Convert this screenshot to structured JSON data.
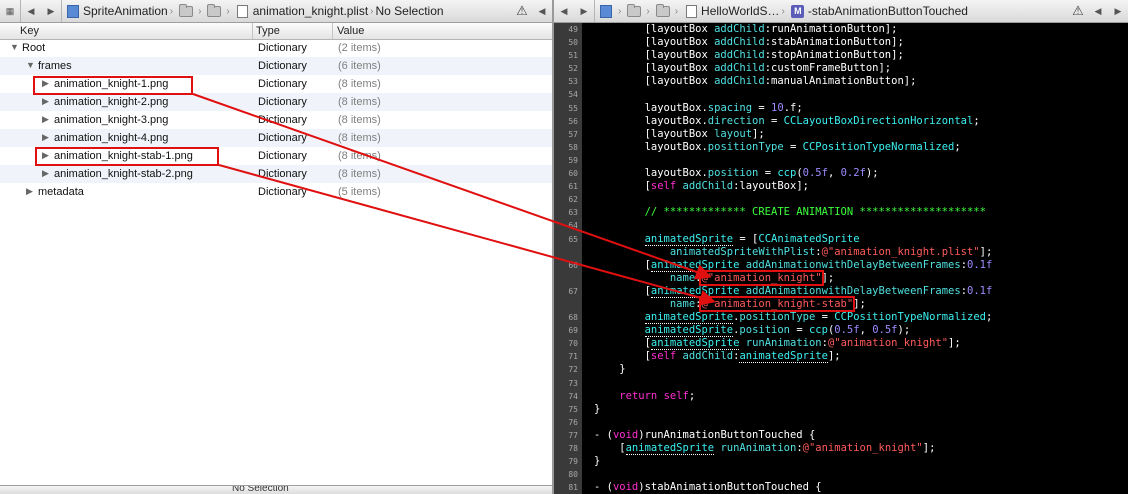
{
  "left_jumpbar": {
    "project": "SpriteAnimation",
    "file": "animation_knight.plist",
    "selection": "No Selection"
  },
  "right_jumpbar": {
    "file": "HelloWorldS…",
    "method": "-stabAnimationButtonTouched"
  },
  "plist": {
    "headers": {
      "key": "Key",
      "type": "Type",
      "value": "Value"
    },
    "rows": [
      {
        "key": "Root",
        "type": "Dictionary",
        "value": "(2 items)",
        "indent": 0,
        "expanded": true
      },
      {
        "key": "frames",
        "type": "Dictionary",
        "value": "(6 items)",
        "indent": 1,
        "expanded": true
      },
      {
        "key": "animation_knight-1.png",
        "type": "Dictionary",
        "value": "(8 items)",
        "indent": 2,
        "expanded": false,
        "highlight": true
      },
      {
        "key": "animation_knight-2.png",
        "type": "Dictionary",
        "value": "(8 items)",
        "indent": 2,
        "expanded": false
      },
      {
        "key": "animation_knight-3.png",
        "type": "Dictionary",
        "value": "(8 items)",
        "indent": 2,
        "expanded": false
      },
      {
        "key": "animation_knight-4.png",
        "type": "Dictionary",
        "value": "(8 items)",
        "indent": 2,
        "expanded": false
      },
      {
        "key": "animation_knight-stab-1.png",
        "type": "Dictionary",
        "value": "(8 items)",
        "indent": 2,
        "expanded": false,
        "highlight": true
      },
      {
        "key": "animation_knight-stab-2.png",
        "type": "Dictionary",
        "value": "(8 items)",
        "indent": 2,
        "expanded": false
      },
      {
        "key": "metadata",
        "type": "Dictionary",
        "value": "(5 items)",
        "indent": 1,
        "expanded": false
      }
    ]
  },
  "status": {
    "selection": "No Selection"
  },
  "code": [
    {
      "n": "49",
      "t": "        [layoutBox addChild:runAnimationButton];"
    },
    {
      "n": "50",
      "t": "        [layoutBox addChild:stabAnimationButton];"
    },
    {
      "n": "51",
      "t": "        [layoutBox addChild:stopAnimationButton];"
    },
    {
      "n": "52",
      "t": "        [layoutBox addChild:customFrameButton];"
    },
    {
      "n": "53",
      "t": "        [layoutBox addChild:manualAnimationButton];"
    },
    {
      "n": "54",
      "t": ""
    },
    {
      "n": "55",
      "t": "        layoutBox.spacing = 10.f;"
    },
    {
      "n": "56",
      "t": "        layoutBox.direction = CCLayoutBoxDirectionHorizontal;"
    },
    {
      "n": "57",
      "t": "        [layoutBox layout];"
    },
    {
      "n": "58",
      "t": "        layoutBox.positionType = CCPositionTypeNormalized;"
    },
    {
      "n": "59",
      "t": ""
    },
    {
      "n": "60",
      "t": "        layoutBox.position = ccp(0.5f, 0.2f);"
    },
    {
      "n": "61",
      "t": "        [self addChild:layoutBox];"
    },
    {
      "n": "62",
      "t": ""
    },
    {
      "n": "63",
      "t": "        // ************* CREATE ANIMATION ********************"
    },
    {
      "n": "64",
      "t": ""
    },
    {
      "n": "65",
      "t": "        animatedSprite = [CCAnimatedSprite"
    },
    {
      "n": "",
      "t": "            animatedSpriteWithPlist:@\"animation_knight.plist\"];"
    },
    {
      "n": "66",
      "t": "        [animatedSprite addAnimationwithDelayBetweenFrames:0.1f"
    },
    {
      "n": "",
      "t": "            name:@\"animation_knight\"];"
    },
    {
      "n": "67",
      "t": "        [animatedSprite addAnimationwithDelayBetweenFrames:0.1f"
    },
    {
      "n": "",
      "t": "            name:@\"animation_knight-stab\"];"
    },
    {
      "n": "68",
      "t": "        animatedSprite.positionType = CCPositionTypeNormalized;"
    },
    {
      "n": "69",
      "t": "        animatedSprite.position = ccp(0.5f, 0.5f);"
    },
    {
      "n": "70",
      "t": "        [animatedSprite runAnimation:@\"animation_knight\"];"
    },
    {
      "n": "71",
      "t": "        [self addChild:animatedSprite];"
    },
    {
      "n": "72",
      "t": "    }"
    },
    {
      "n": "73",
      "t": ""
    },
    {
      "n": "74",
      "t": "    return self;"
    },
    {
      "n": "75",
      "t": "}"
    },
    {
      "n": "76",
      "t": ""
    },
    {
      "n": "77",
      "t": "- (void)runAnimationButtonTouched {"
    },
    {
      "n": "78",
      "t": "    [animatedSprite runAnimation:@\"animation_knight\"];"
    },
    {
      "n": "79",
      "t": "}"
    },
    {
      "n": "80",
      "t": ""
    },
    {
      "n": "81",
      "t": "- (void)stabAnimationButtonTouched {"
    }
  ],
  "colors": {
    "annotation_red": "#e01010",
    "editor_bg": "#000000",
    "keyword": "#ff2fd0",
    "string": "#ff5a5a",
    "comment": "#3cff3c",
    "class": "#3cf0f0"
  }
}
